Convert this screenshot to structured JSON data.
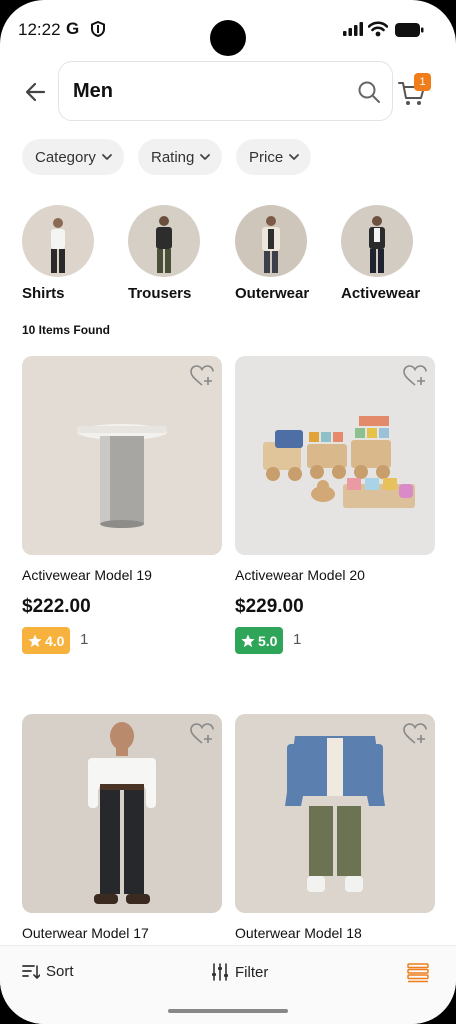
{
  "status_bar": {
    "time": "12:22",
    "app_letter": "G"
  },
  "header": {
    "search_value": "Men",
    "cart_count": "1"
  },
  "filters": [
    {
      "label": "Category"
    },
    {
      "label": "Rating"
    },
    {
      "label": "Price"
    }
  ],
  "categories": [
    {
      "label": "Shirts"
    },
    {
      "label": "Trousers"
    },
    {
      "label": "Outerwear"
    },
    {
      "label": "Activewear"
    }
  ],
  "results": {
    "count_text": "10 Items Found"
  },
  "products": [
    {
      "name": "Activewear Model 19",
      "price": "$222.00",
      "rating": "4.0",
      "rating_count": "1",
      "rating_color": "#f6b23d"
    },
    {
      "name": "Activewear Model 20",
      "price": "$229.00",
      "rating": "5.0",
      "rating_count": "1",
      "rating_color": "#2fa55a"
    },
    {
      "name": "Outerwear Model 17",
      "price": "",
      "rating": "",
      "rating_count": ""
    },
    {
      "name": "Outerwear Model 18",
      "price": "",
      "rating": "",
      "rating_count": ""
    }
  ],
  "bottom_bar": {
    "sort_label": "Sort",
    "filter_label": "Filter"
  },
  "colors": {
    "accent": "#f07c1a"
  }
}
